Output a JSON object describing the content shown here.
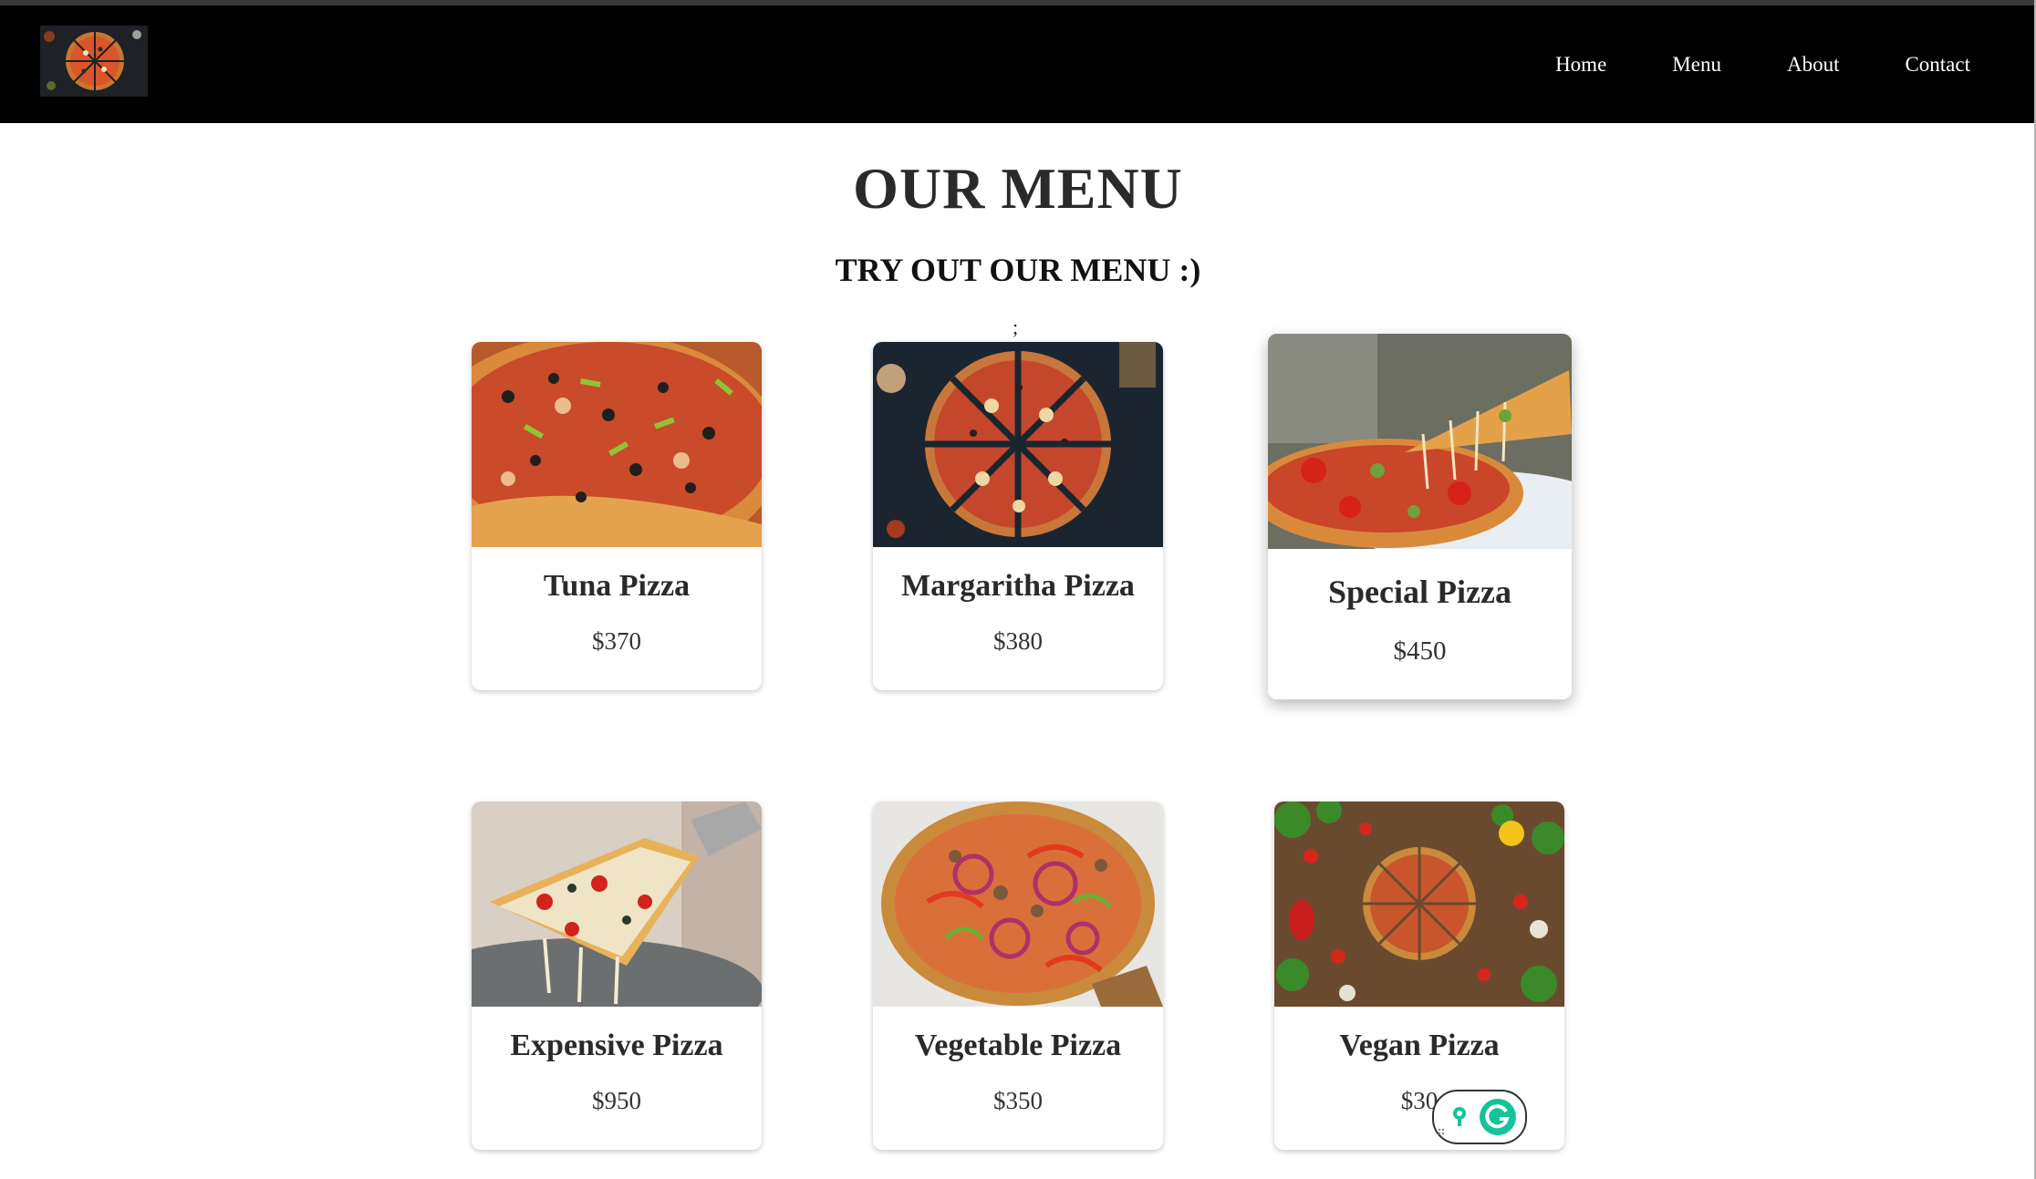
{
  "nav": {
    "logo_icon": "pizza-logo-image",
    "links": [
      {
        "label": "Home"
      },
      {
        "label": "Menu"
      },
      {
        "label": "About"
      },
      {
        "label": "Contact"
      }
    ]
  },
  "page": {
    "title": "OUR MENU",
    "subtitle": "TRY OUT OUR MENU :)",
    "stray_text": ";"
  },
  "menu": [
    {
      "name": "Tuna Pizza",
      "price": "$370",
      "image": "tuna-pizza-photo"
    },
    {
      "name": "Margaritha Pizza",
      "price": "$380",
      "image": "margaritha-pizza-photo"
    },
    {
      "name": "Special Pizza",
      "price": "$450",
      "image": "special-pizza-photo"
    },
    {
      "name": "Expensive Pizza",
      "price": "$950",
      "image": "expensive-pizza-photo"
    },
    {
      "name": "Vegetable Pizza",
      "price": "$350",
      "image": "vegetable-pizza-photo"
    },
    {
      "name": "Vegan Pizza",
      "price": "$30",
      "image": "vegan-pizza-photo"
    }
  ],
  "colors": {
    "navbar_bg": "#000000",
    "nav_text": "#ffffff",
    "title": "#2a2a2a",
    "grammarly_green": "#15c39a"
  },
  "overlay": {
    "icon": "grammarly-icon"
  }
}
